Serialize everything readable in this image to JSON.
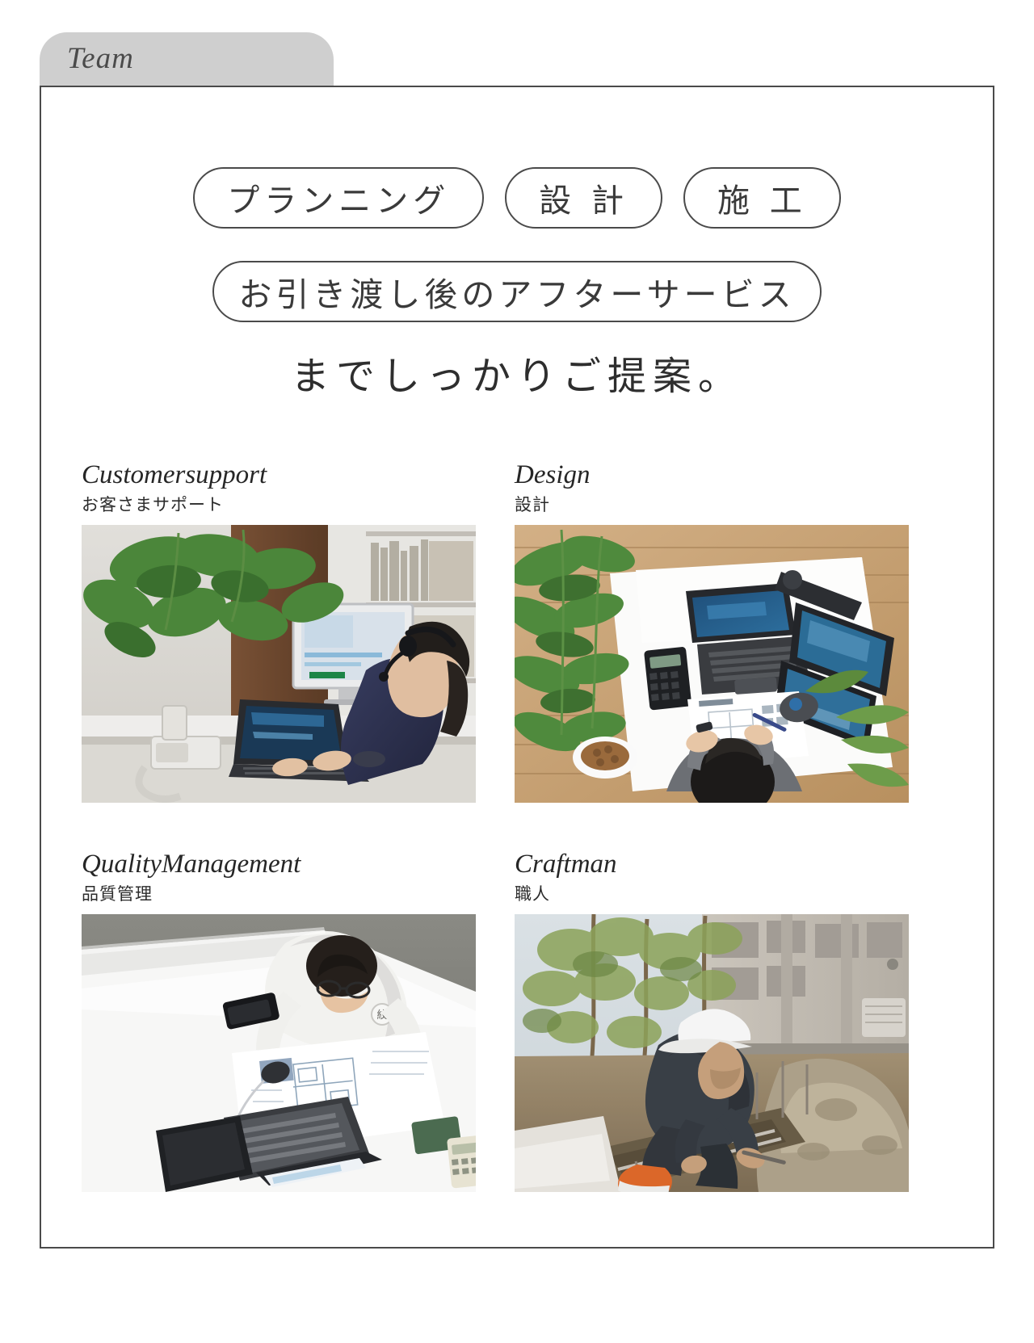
{
  "section": {
    "tab_label": "Team"
  },
  "pills": {
    "row1": [
      {
        "name": "pill-planning",
        "label": "プランニング"
      },
      {
        "name": "pill-design",
        "label": "設 計"
      },
      {
        "name": "pill-construction",
        "label": "施 工"
      }
    ],
    "row2": [
      {
        "name": "pill-aftersales",
        "label": "お引き渡し後のアフターサービス"
      }
    ]
  },
  "tagline": "までしっかりご提案。",
  "cards": [
    {
      "name": "card-customersupport",
      "title_en": "Customersupport",
      "title_ja": "お客さまサポート",
      "photo": "customer-support-photo",
      "photo_alt": "オペレーターがヘッドセットでPC作業"
    },
    {
      "name": "card-design",
      "title_en": "Design",
      "title_ja": "設計",
      "photo": "design-photo",
      "photo_alt": "デスクで図面を確認する設計者"
    },
    {
      "name": "card-qualitymanagement",
      "title_en": "QualityManagement",
      "title_ja": "品質管理",
      "photo": "quality-management-photo",
      "photo_alt": "図面を確認する品質管理担当者"
    },
    {
      "name": "card-craftman",
      "title_en": "Craftman",
      "title_ja": "職人",
      "photo": "craftman-photo",
      "photo_alt": "基礎工事を行う職人"
    }
  ],
  "colors": {
    "tab_background": "#cfcfcf",
    "frame_border": "#4a4a4a",
    "text_primary": "#2e2e2e",
    "page_background": "#ffffff"
  }
}
